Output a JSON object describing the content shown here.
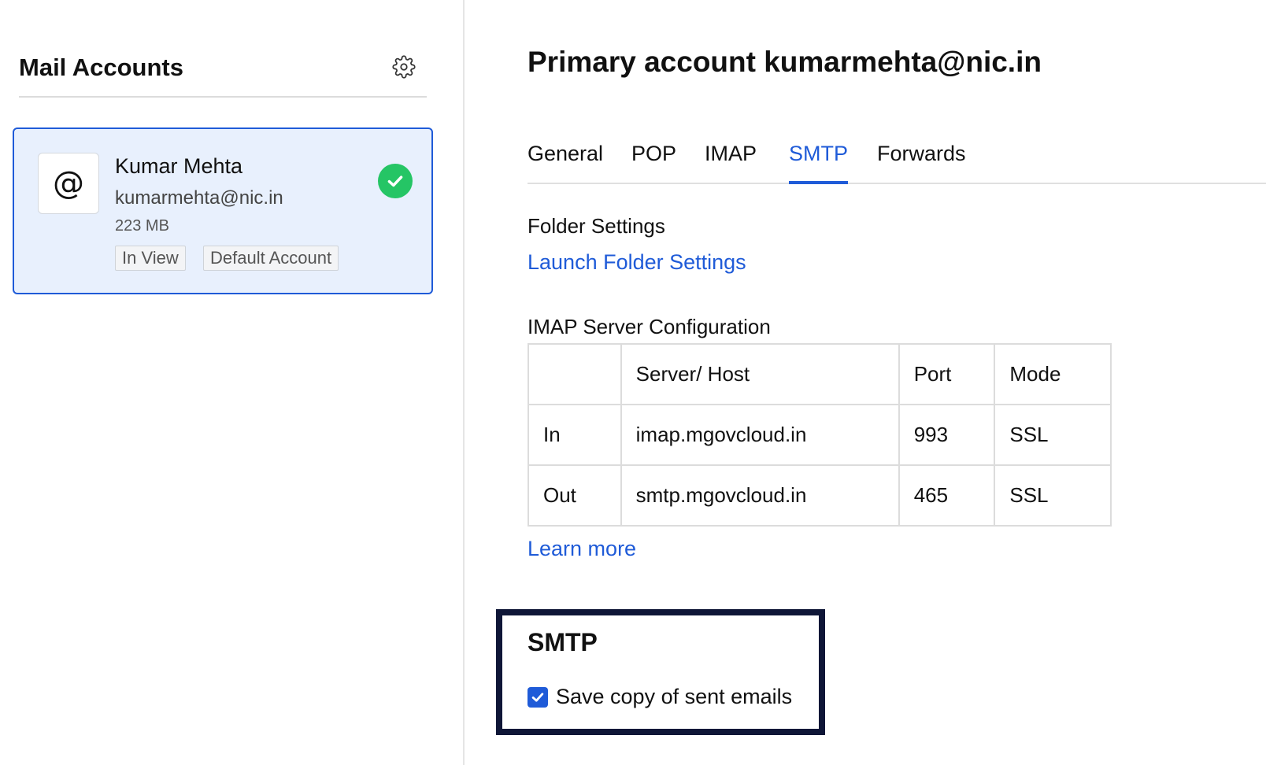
{
  "sidebar": {
    "title": "Mail Accounts",
    "account": {
      "avatar_symbol": "@",
      "name": "Kumar Mehta",
      "email": "kumarmehta@nic.in",
      "size": "223 MB",
      "tags": [
        "In View",
        "Default Account"
      ],
      "status_icon": "check-circle-icon",
      "status_color": "#25c565"
    }
  },
  "main": {
    "title": "Primary account kumarmehta@nic.in",
    "tabs": [
      {
        "label": "General"
      },
      {
        "label": "POP"
      },
      {
        "label": "IMAP"
      },
      {
        "label": "SMTP",
        "active": true
      },
      {
        "label": "Forwards"
      }
    ],
    "folder_settings": {
      "label": "Folder Settings",
      "link": "Launch Folder Settings"
    },
    "imap_config": {
      "label": "IMAP Server Configuration",
      "headers": [
        "",
        "Server/ Host",
        "Port",
        "Mode"
      ],
      "rows": [
        [
          "In",
          "imap.mgovcloud.in",
          "993",
          "SSL"
        ],
        [
          "Out",
          "smtp.mgovcloud.in",
          "465",
          "SSL"
        ]
      ],
      "learn_more": "Learn more"
    },
    "smtp": {
      "title": "SMTP",
      "save_copy_label": "Save copy of sent emails",
      "save_copy_checked": true
    }
  },
  "colors": {
    "accent": "#1f5bd8",
    "card_bg": "#e8f0fd",
    "highlight_border": "#0f1637"
  }
}
